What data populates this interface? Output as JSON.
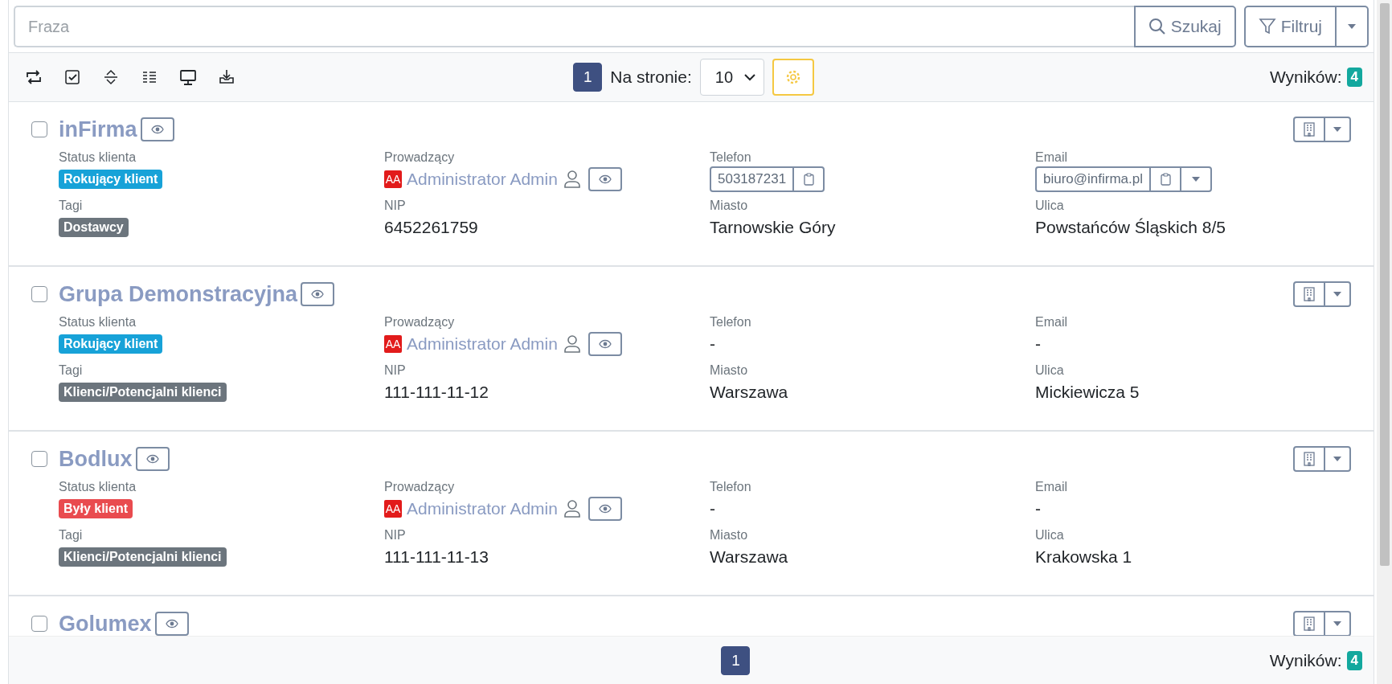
{
  "search": {
    "placeholder": "Fraza",
    "search_button": "Szukaj",
    "filter_button": "Filtruj"
  },
  "toolbar": {
    "pages": [
      {
        "label": "1",
        "selected": true
      }
    ],
    "per_page_label": "Na stronie:",
    "per_page": "10",
    "results_label": "Wyników:",
    "results_count": "4"
  },
  "clients": [
    {
      "name": "inFirma",
      "checked": false,
      "status_label": "Status klienta",
      "status": {
        "text": "Rokujący klient",
        "color": "#17a2d8"
      },
      "owner_label": "Prowadzący",
      "owner_initials": "AA",
      "owner_name": "Administrator Admin",
      "phone_label": "Telefon",
      "phone": {
        "kind": "field",
        "value": "503187231"
      },
      "email_label": "Email",
      "email": {
        "kind": "field",
        "value": "biuro@infirma.pl"
      },
      "tags_label": "Tagi",
      "tag": "Dostawcy",
      "nip_label": "NIP",
      "nip": "6452261759",
      "city_label": "Miasto",
      "city": "Tarnowskie Góry",
      "street_label": "Ulica",
      "street": "Powstańców Śląskich 8/5"
    },
    {
      "name": "Grupa Demonstracyjna",
      "checked": false,
      "status_label": "Status klienta",
      "status": {
        "text": "Rokujący klient",
        "color": "#17a2d8"
      },
      "owner_label": "Prowadzący",
      "owner_initials": "AA",
      "owner_name": "Administrator Admin",
      "phone_label": "Telefon",
      "phone": {
        "kind": "text",
        "value": "-"
      },
      "email_label": "Email",
      "email": {
        "kind": "text",
        "value": "-"
      },
      "tags_label": "Tagi",
      "tag": "Klienci/Potencjalni klienci",
      "nip_label": "NIP",
      "nip": "111-111-11-12",
      "city_label": "Miasto",
      "city": "Warszawa",
      "street_label": "Ulica",
      "street": "Mickiewicza 5"
    },
    {
      "name": "Bodlux",
      "checked": false,
      "status_label": "Status klienta",
      "status": {
        "text": "Były klient",
        "color": "#e94b4f"
      },
      "owner_label": "Prowadzący",
      "owner_initials": "AA",
      "owner_name": "Administrator Admin",
      "phone_label": "Telefon",
      "phone": {
        "kind": "text",
        "value": "-"
      },
      "email_label": "Email",
      "email": {
        "kind": "text",
        "value": "-"
      },
      "tags_label": "Tagi",
      "tag": "Klienci/Potencjalni klienci",
      "nip_label": "NIP",
      "nip": "111-111-11-13",
      "city_label": "Miasto",
      "city": "Warszawa",
      "street_label": "Ulica",
      "street": "Krakowska 1"
    },
    {
      "name": "Golumex",
      "checked": false
    }
  ],
  "footer": {
    "pages": [
      {
        "label": "1",
        "selected": true
      }
    ],
    "results_label": "Wyników:",
    "results_count": "4"
  }
}
